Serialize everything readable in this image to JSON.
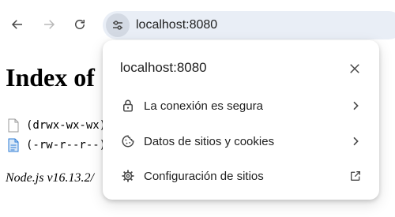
{
  "toolbar": {
    "url": "localhost:8080",
    "icons": {
      "back": "arrow-left-icon",
      "forward": "arrow-right-icon",
      "reload": "reload-icon",
      "site_info": "tune-icon"
    }
  },
  "page": {
    "title": "Index of",
    "entries": [
      {
        "text": "(drwx-wx-wx)",
        "icon": "blank-file-icon"
      },
      {
        "text": "(-rw-r--r--)",
        "icon": "blue-file-icon"
      }
    ],
    "footer": "Node.js v16.13.2/"
  },
  "popup": {
    "title": "localhost:8080",
    "items": [
      {
        "label": "La conexión es segura",
        "icon": "lock-icon",
        "trailing": "chevron-right-icon"
      },
      {
        "label": "Datos de sitios y cookies",
        "icon": "cookie-icon",
        "trailing": "chevron-right-icon"
      },
      {
        "label": "Configuración de sitios",
        "icon": "gear-icon",
        "trailing": "external-link-icon"
      }
    ]
  },
  "colors": {
    "omnibox": "#e9eef6",
    "icon": "#474747",
    "file_blue": "#2b7bd6"
  }
}
